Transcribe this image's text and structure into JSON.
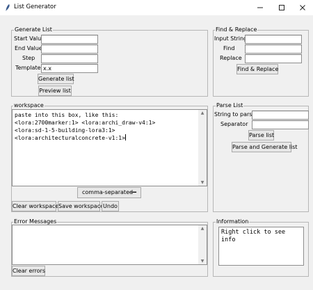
{
  "window": {
    "title": "List Generator",
    "minimize_icon": "minimize-icon",
    "maximize_icon": "maximize-icon",
    "close_icon": "close-icon"
  },
  "generate_list": {
    "legend": "Generate List",
    "start_label": "Start Value",
    "start_value": "",
    "end_label": "End Value",
    "end_value": "",
    "step_label": "Step",
    "step_value": "",
    "template_label": "Template",
    "template_value": "x.x",
    "generate_button": "Generate list",
    "preview_button": "Preview list"
  },
  "find_replace": {
    "legend": "Find & Replace",
    "input_label": "Input String",
    "input_value": "",
    "find_label": "Find",
    "find_value": "",
    "replace_label": "Replace",
    "replace_value": "",
    "button": "Find & Replace"
  },
  "workspace": {
    "legend": "workspace",
    "lines": [
      "paste into this box, like this:",
      "<lora:2700marker:1> <lora:archi_draw-v4:1>",
      "<lora:sd-1-5-building-lora3:1>",
      "<lora:architecturalconcrete-v1:1>"
    ],
    "separator_option": "comma-separated",
    "clear_button": "Clear workspace",
    "save_button": "Save workspace",
    "undo_button": "Undo"
  },
  "parse_list": {
    "legend": "Parse List",
    "string_label": "String to parse",
    "string_value": "",
    "separator_label": "Separator",
    "separator_value": "",
    "parse_button": "Parse list",
    "parse_generate_button": "Parse and Generate list"
  },
  "error_messages": {
    "legend": "Error Messages",
    "content": "",
    "clear_button": "Clear errors"
  },
  "information": {
    "legend": "Information",
    "lines": [
      "Right click to see",
      "info"
    ]
  }
}
